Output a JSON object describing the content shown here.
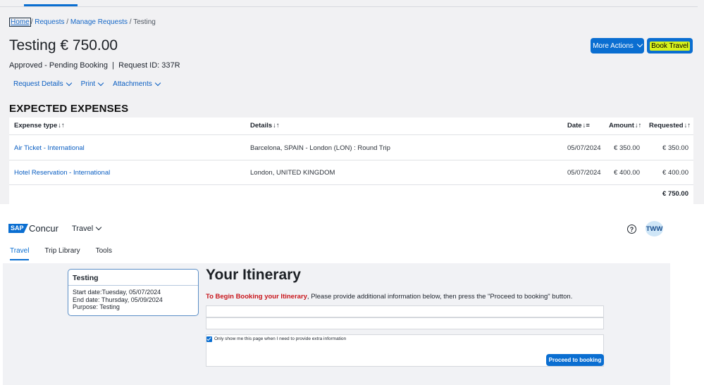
{
  "breadcrumb": {
    "home": "Home",
    "requests": "Requests",
    "manage": "Manage Requests",
    "current": "Testing",
    "separator": "/"
  },
  "request": {
    "title": "Testing € 750.00",
    "status": "Approved - Pending Booking",
    "id_text": "Request ID: 337R",
    "links": [
      "Request Details",
      "Print",
      "Attachments"
    ]
  },
  "actions": {
    "more_actions": "More Actions",
    "book_travel": "Book Travel"
  },
  "expenses": {
    "heading": "EXPECTED EXPENSES",
    "columns": {
      "type": "Expense type",
      "details": "Details",
      "date": "Date",
      "amount": "Amount",
      "requested": "Requested"
    },
    "rows": [
      {
        "type": "Air Ticket - International",
        "details": "Barcelona, SPAIN - London (LON) : Round Trip",
        "date": "05/07/2024",
        "amount": "€ 350.00",
        "requested": "€ 350.00"
      },
      {
        "type": "Hotel Reservation - International",
        "details": "London, UNITED KINGDOM",
        "date": "05/07/2024",
        "amount": "€ 400.00",
        "requested": "€ 400.00"
      }
    ],
    "total": "€ 750.00"
  },
  "concur": {
    "logo_badge": "SAP",
    "logo_word": "Concur",
    "product_menu": "Travel",
    "help_glyph": "?",
    "avatar_initials": "TWW",
    "tabs": [
      "Travel",
      "Trip Library",
      "Tools"
    ],
    "active_tab": "Travel"
  },
  "trip_card": {
    "title": "Testing",
    "start": "Start date:Tuesday, 05/07/2024",
    "end": "End date:  Thursday, 05/09/2024",
    "purpose": "Purpose:  Testing"
  },
  "itinerary": {
    "title": "Your Itinerary",
    "msg_red": "To Begin Booking your Itinerary",
    "msg_rest": ", Please provide additional information below, then press the \"Proceed to booking\" button.",
    "option_label": "Only show me this page when I need to provide extra information",
    "proceed": "Proceed to booking"
  },
  "colors": {
    "brand_blue": "#0a6ed1",
    "highlight": "#d7f21c",
    "alert_red": "#c8151b"
  },
  "icons": [
    "chevron-down-icon",
    "sort-icon",
    "help-icon",
    "checkbox-checked-icon"
  ]
}
